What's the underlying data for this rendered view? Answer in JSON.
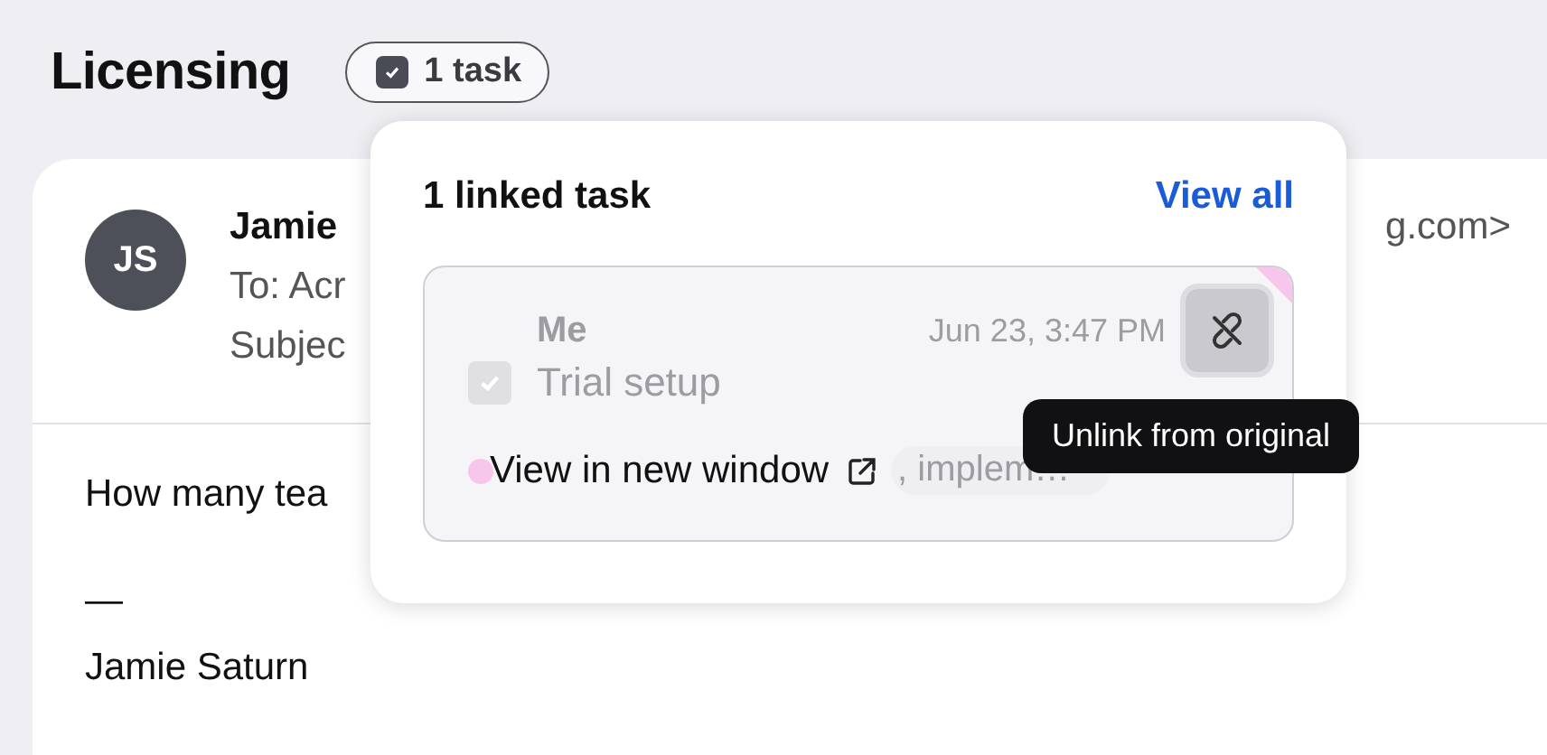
{
  "page": {
    "title": "Licensing",
    "task_badge": {
      "label": "1 task",
      "checked": true
    }
  },
  "email": {
    "avatar": "JS",
    "sender": "Jamie",
    "sender_address": "g.com>",
    "to": "To: Acr",
    "subject": "Subjec",
    "body": "How many tea",
    "signature_dash": "—",
    "signature": "Jamie Saturn"
  },
  "popover": {
    "title": "1 linked task",
    "view_all": "View all",
    "task": {
      "assignee": "Me",
      "date": "Jun 23, 3:47 PM",
      "name": "Trial setup",
      "checked": true,
      "chip": ", implem…",
      "view_link": "View in new window"
    },
    "tooltip": "Unlink from original"
  }
}
